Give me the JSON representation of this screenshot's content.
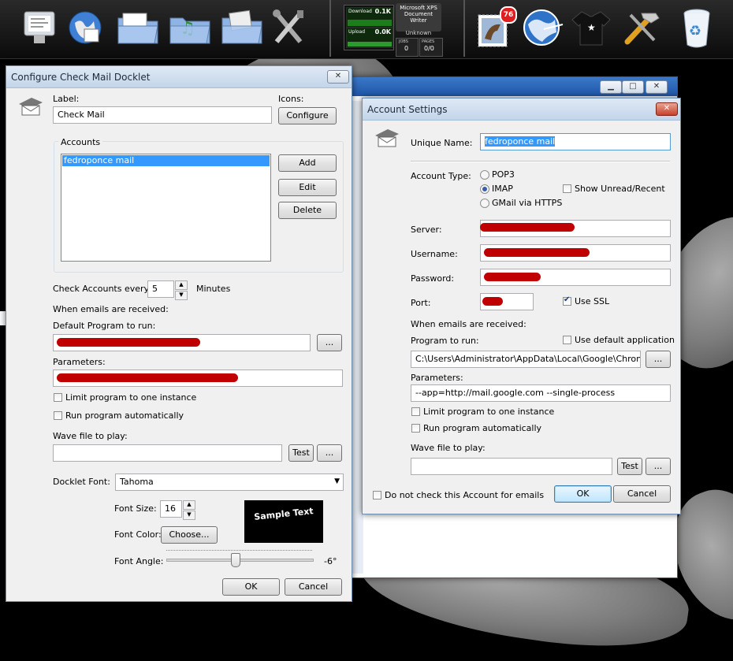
{
  "colors": {
    "accent": "#3399ff",
    "redaction": "#c00000",
    "dock_badge": "#e02020"
  },
  "dock": {
    "items": [
      {
        "name": "system-preferences-icon"
      },
      {
        "name": "network-globe-icon"
      },
      {
        "name": "documents-folder-icon"
      },
      {
        "name": "music-folder-icon"
      },
      {
        "name": "pictures-folder-icon"
      },
      {
        "name": "tools-icon"
      },
      {
        "name": "mail-stamp-icon",
        "badge": "76"
      },
      {
        "name": "web-globe-icon"
      },
      {
        "name": "tshirt-icon"
      },
      {
        "name": "hammer-icon"
      },
      {
        "name": "recycle-bin-icon"
      }
    ],
    "network": {
      "download": "Download",
      "download_val": "0.1K",
      "upload": "Upload",
      "upload_val": "0.0K"
    },
    "printer": {
      "name": "Microsoft XPS Document Writer",
      "status": "Unknown",
      "jobs_label": "JOBS",
      "jobs_val": "0",
      "pages_label": "PAGES",
      "pages_val": "0/0"
    }
  },
  "checkmail": {
    "title": "Configure Check Mail Docklet",
    "label_caption": "Label:",
    "label_value": "Check Mail",
    "icons_caption": "Icons:",
    "configure": "Configure",
    "accounts_caption": "Accounts",
    "accounts": [
      "fedroponce mail"
    ],
    "add": "Add",
    "edit": "Edit",
    "delete": "Delete",
    "check_every": "Check Accounts every:",
    "interval": "5",
    "minutes": "Minutes",
    "when_received": "When emails are received:",
    "default_program": "Default Program to run:",
    "browse": "...",
    "parameters": "Parameters:",
    "limit_one": "Limit program to one instance",
    "run_auto": "Run program automatically",
    "wave": "Wave file to play:",
    "test": "Test",
    "font_label": "Docklet Font:",
    "font_value": "Tahoma",
    "size_label": "Font Size:",
    "size_value": "16",
    "color_label": "Font Color:",
    "choose": "Choose...",
    "sample": "Sample Text",
    "angle_label": "Font Angle:",
    "angle_value": "-6°",
    "ok": "OK",
    "cancel": "Cancel"
  },
  "account": {
    "title": "Account Settings",
    "unique_label": "Unique Name:",
    "unique_value": "fedroponce mail",
    "type_label": "Account Type:",
    "types": [
      "POP3",
      "IMAP",
      "GMail via HTTPS"
    ],
    "selected_type": "IMAP",
    "show_unread": "Show Unread/Recent",
    "server": "Server:",
    "username": "Username:",
    "password": "Password:",
    "port": "Port:",
    "use_ssl": "Use SSL",
    "when_received": "When emails are received:",
    "program": "Program to run:",
    "use_default": "Use default application",
    "program_value": "C:\\Users\\Administrator\\AppData\\Local\\Google\\Chrome\\App",
    "browse": "...",
    "parameters": "Parameters:",
    "params_value": "--app=http://mail.google.com --single-process",
    "limit_one": "Limit program to one instance",
    "run_auto": "Run program automatically",
    "wave": "Wave file to play:",
    "test": "Test",
    "do_not_check": "Do not check this Account for emails",
    "ok": "OK",
    "cancel": "Cancel"
  }
}
